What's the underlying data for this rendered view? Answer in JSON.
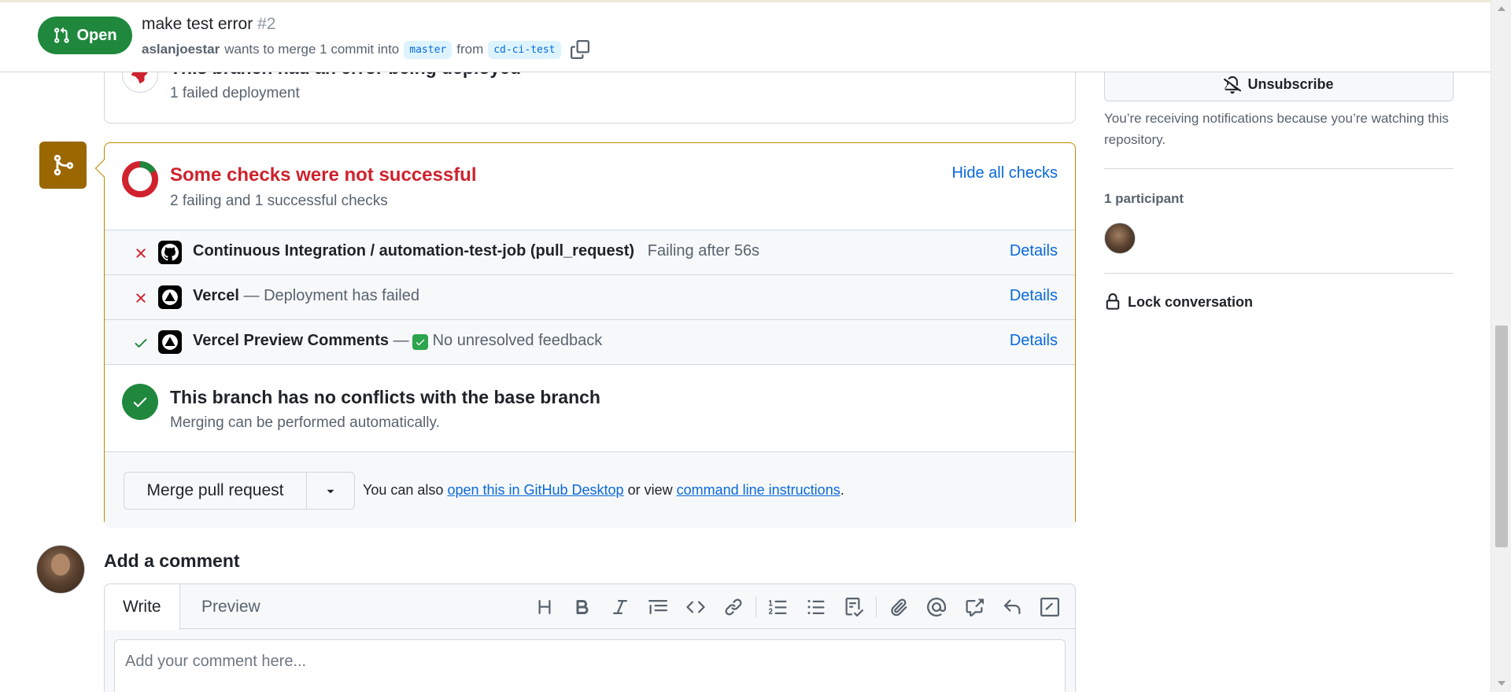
{
  "header": {
    "state_label": "Open",
    "title": "make test error",
    "number": "#2",
    "author": "aslanjoestar",
    "meta_text": "wants to merge 1 commit into",
    "base_branch": "master",
    "from_text": "from",
    "head_branch": "cd-ci-test"
  },
  "deployment": {
    "title": "This branch had an error being deployed",
    "subtitle": "1 failed deployment"
  },
  "checks": {
    "title": "Some checks were not successful",
    "subtitle": "2 failing and 1 successful checks",
    "toggle_label": "Hide all checks",
    "items": [
      {
        "status": "failing",
        "app": "github-icon",
        "name": "Continuous Integration / automation-test-job (pull_request)",
        "description": "Failing after 56s",
        "details_label": "Details"
      },
      {
        "status": "failing",
        "app": "vercel-icon",
        "name": "Vercel",
        "description": "— Deployment has failed",
        "details_label": "Details"
      },
      {
        "status": "success",
        "app": "vercel-icon",
        "name": "Vercel Preview Comments",
        "description_prefix": "—",
        "description": "No unresolved feedback",
        "details_label": "Details"
      }
    ]
  },
  "conflicts": {
    "title": "This branch has no conflicts with the base branch",
    "subtitle": "Merging can be performed automatically."
  },
  "merge": {
    "button_label": "Merge pull request",
    "hint_prefix": "You can also",
    "desktop_link": "open this in GitHub Desktop",
    "hint_middle": "or view",
    "cli_link": "command line instructions",
    "hint_suffix": "."
  },
  "comment": {
    "title": "Add a comment",
    "tab_write": "Write",
    "tab_preview": "Preview",
    "placeholder": "Add your comment here..."
  },
  "sidebar": {
    "unsubscribe_label": "Unsubscribe",
    "notification_note": "You’re receiving notifications because you’re watching this repository.",
    "participants_label": "1 participant",
    "lock_label": "Lock conversation"
  },
  "colors": {
    "open_green": "#1f883d",
    "fail_red": "#cf222e",
    "warning_border": "#bf8700",
    "link_blue": "#0969da"
  }
}
